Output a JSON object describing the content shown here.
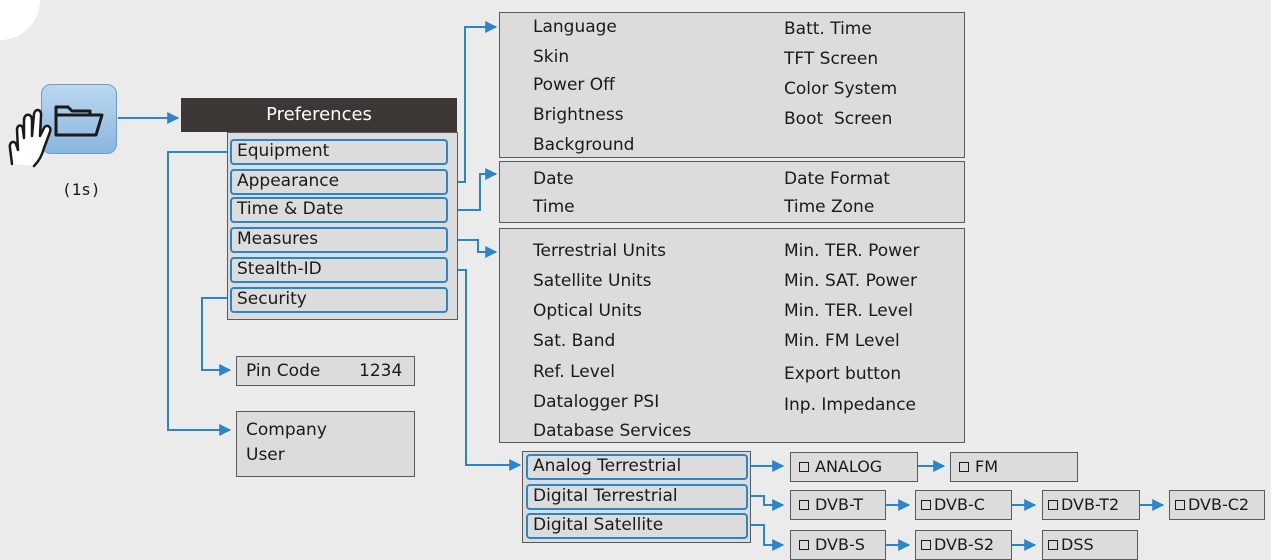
{
  "icon": {
    "name": "folder-icon",
    "hand": "hand-tap-icon",
    "hold_label": "(1s)"
  },
  "colors": {
    "arrow": "#2a86c8",
    "header_bg": "#3c3735",
    "box_bg": "#dcdcdc",
    "background": "#ebebeb"
  },
  "preferences": {
    "title": "Preferences",
    "items": [
      "Equipment",
      "Appearance",
      "Time & Date",
      "Measures",
      "Stealth-ID",
      "Security"
    ]
  },
  "appearance_options": {
    "left": [
      "Language",
      "Skin",
      "Power Off",
      "Brightness",
      "Background"
    ],
    "right": [
      "Batt. Time",
      "TFT Screen",
      "Color System",
      "Boot  Screen"
    ]
  },
  "time_date_options": {
    "left": [
      "Date",
      "Time"
    ],
    "right": [
      "Date Format",
      "Time Zone"
    ]
  },
  "measures_options": {
    "left": [
      "Terrestrial Units",
      "Satellite Units",
      "Optical Units",
      "Sat. Band",
      "Ref. Level",
      "Datalogger PSI",
      "Database Services"
    ],
    "right": [
      "Min. TER. Power",
      "Min. SAT. Power",
      "Min. TER. Level",
      "Min. FM Level",
      "Export button",
      "Inp. Impedance"
    ]
  },
  "security": {
    "label": "Pin Code",
    "value": "1234"
  },
  "equipment": {
    "lines": [
      "Company",
      "User"
    ]
  },
  "stealth_id": {
    "groups": [
      "Analog Terrestrial",
      "Digital Terrestrial",
      "Digital Satellite"
    ],
    "analog_terrestrial": [
      "ANALOG",
      "FM"
    ],
    "digital_terrestrial": [
      "DVB-T",
      "DVB-C",
      "DVB-T2",
      "DVB-C2"
    ],
    "digital_satellite": [
      "DVB-S",
      "DVB-S2",
      "DSS"
    ]
  }
}
